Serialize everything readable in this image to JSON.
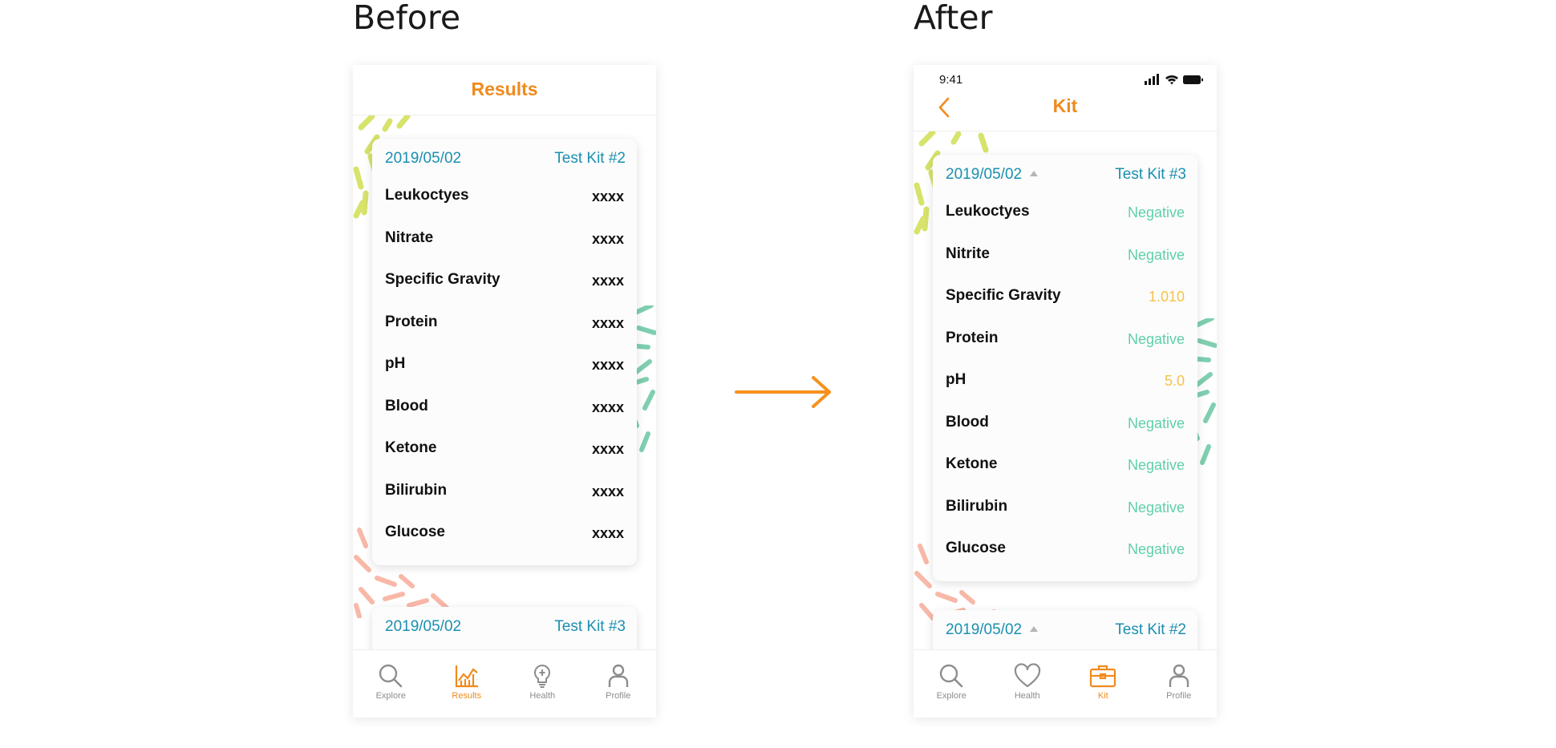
{
  "headings": {
    "before": "Before",
    "after": "After"
  },
  "colors": {
    "accent": "#f08a1c",
    "link_blue": "#1a8fb0",
    "negative_green": "#5ed0a9",
    "warning_yellow": "#f5c24b"
  },
  "before": {
    "title": "Results",
    "card": {
      "date": "2019/05/02",
      "kit": "Test Kit #2",
      "rows": [
        {
          "name": "Leukoctyes",
          "value": "xxxx"
        },
        {
          "name": "Nitrate",
          "value": "xxxx"
        },
        {
          "name": "Specific Gravity",
          "value": "xxxx"
        },
        {
          "name": "Protein",
          "value": "xxxx"
        },
        {
          "name": "pH",
          "value": "xxxx"
        },
        {
          "name": "Blood",
          "value": "xxxx"
        },
        {
          "name": "Ketone",
          "value": "xxxx"
        },
        {
          "name": "Bilirubin",
          "value": "xxxx"
        },
        {
          "name": "Glucose",
          "value": "xxxx"
        }
      ]
    },
    "next_card": {
      "date": "2019/05/02",
      "kit": "Test Kit #3"
    },
    "tabs": [
      {
        "label": "Explore",
        "icon": "search-icon"
      },
      {
        "label": "Results",
        "icon": "chart-icon",
        "active": true
      },
      {
        "label": "Health",
        "icon": "lightbulb-icon"
      },
      {
        "label": "Profile",
        "icon": "person-icon"
      }
    ]
  },
  "after": {
    "status_time": "9:41",
    "title": "Kit",
    "card": {
      "date": "2019/05/02",
      "kit": "Test Kit #3",
      "rows": [
        {
          "name": "Leukoctyes",
          "value": "Negative",
          "status": "negative"
        },
        {
          "name": "Nitrite",
          "value": "Negative",
          "status": "negative"
        },
        {
          "name": "Specific Gravity",
          "value": "1.010",
          "status": "warning"
        },
        {
          "name": "Protein",
          "value": "Negative",
          "status": "negative"
        },
        {
          "name": "pH",
          "value": "5.0",
          "status": "warning"
        },
        {
          "name": "Blood",
          "value": "Negative",
          "status": "negative"
        },
        {
          "name": "Ketone",
          "value": "Negative",
          "status": "negative"
        },
        {
          "name": "Bilirubin",
          "value": "Negative",
          "status": "negative"
        },
        {
          "name": "Glucose",
          "value": "Negative",
          "status": "negative"
        }
      ]
    },
    "next_card": {
      "date": "2019/05/02",
      "kit": "Test Kit #2"
    },
    "tabs": [
      {
        "label": "Explore",
        "icon": "search-icon"
      },
      {
        "label": "Health",
        "icon": "heart-icon"
      },
      {
        "label": "Kit",
        "icon": "briefcase-icon",
        "active": true
      },
      {
        "label": "Profile",
        "icon": "person-icon"
      }
    ]
  }
}
